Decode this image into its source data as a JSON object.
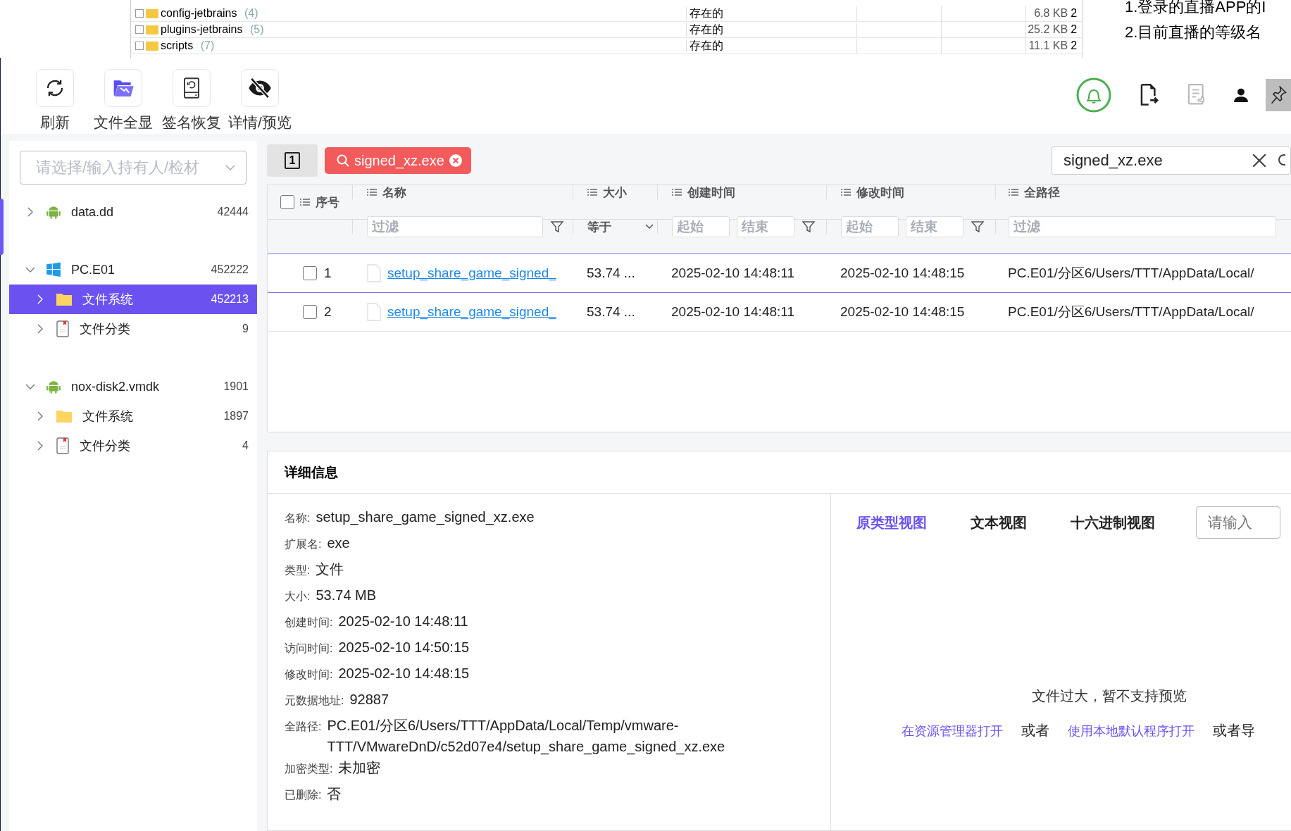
{
  "background_window": {
    "rows": [
      {
        "name": "config-jetbrains",
        "count": "(4)",
        "checked": false,
        "status": "存在的",
        "size": "6.8 KB",
        "col_5": "2"
      },
      {
        "name": "plugins-jetbrains",
        "count": "(5)",
        "checked": false,
        "status": "存在的",
        "size": "25.2 KB",
        "col_5": "2"
      },
      {
        "name": "scripts",
        "count": "(7)",
        "checked": false,
        "status": "存在的",
        "size": "11.1 KB",
        "col_5": "2"
      }
    ],
    "notes": [
      "1.登录的直播APP的I",
      "2.目前直播的等级名"
    ]
  },
  "toolbar": {
    "buttons": [
      {
        "label": "刷新",
        "kind": "refresh"
      },
      {
        "label": "文件全显",
        "kind": "folder"
      },
      {
        "label": "签名恢复",
        "kind": "disk"
      },
      {
        "label": "详情/预览",
        "kind": "eye-off"
      }
    ]
  },
  "sidebar": {
    "owner_select": {
      "placeholder": "请选择/输入持有人/检材"
    },
    "tree": [
      {
        "label": "data.dd",
        "count": "42444",
        "kind": "android",
        "expanded": false,
        "selected": false
      },
      {
        "label": "PC.E01",
        "count": "452222",
        "kind": "windows",
        "expanded": true,
        "selected": false,
        "children": [
          {
            "label": "文件系统",
            "count": "452213",
            "kind": "folder",
            "expanded": false,
            "selected": true
          },
          {
            "label": "文件分类",
            "count": "9",
            "kind": "doc",
            "expanded": false,
            "selected": false
          }
        ]
      },
      {
        "label": "nox-disk2.vmdk",
        "count": "1901",
        "kind": "android",
        "expanded": true,
        "selected": false,
        "children": [
          {
            "label": "文件系统",
            "count": "1897",
            "kind": "folder",
            "expanded": false,
            "selected": false
          },
          {
            "label": "文件分类",
            "count": "4",
            "kind": "doc",
            "expanded": false,
            "selected": false
          }
        ]
      }
    ]
  },
  "search_bar": {
    "tab_number": "1",
    "tag": "signed_xz.exe",
    "value": "signed_xz.exe"
  },
  "table": {
    "columns": [
      "序号",
      "名称",
      "大小",
      "创建时间",
      "修改时间",
      "全路径"
    ],
    "select_all_checked": false,
    "filters": {
      "name": {
        "placeholder": "过滤"
      },
      "size": {
        "value": "等于"
      },
      "created_from": {
        "placeholder": "起始"
      },
      "created_to": {
        "placeholder": "结束"
      },
      "modified_from": {
        "placeholder": "起始"
      },
      "modified_to": {
        "placeholder": "结束"
      },
      "path": {
        "placeholder": "过滤"
      }
    },
    "rows": [
      {
        "index": "1",
        "checked": false,
        "selected": true,
        "name": "setup_share_game_signed_",
        "size": "53.74 ...",
        "created": "2025-02-10 14:48:11",
        "modified": "2025-02-10 14:48:15",
        "path": "PC.E01/分区6/Users/TTT/AppData/Local/"
      },
      {
        "index": "2",
        "checked": false,
        "selected": false,
        "name": "setup_share_game_signed_",
        "size": "53.74 ...",
        "created": "2025-02-10 14:48:11",
        "modified": "2025-02-10 14:48:15",
        "path": "PC.E01/分区6/Users/TTT/AppData/Local/"
      }
    ]
  },
  "details": {
    "title": "详细信息",
    "fields": [
      {
        "label": "名称:",
        "value": "setup_share_game_signed_xz.exe"
      },
      {
        "label": "扩展名:",
        "value": "exe"
      },
      {
        "label": "类型:",
        "value": "文件"
      },
      {
        "label": "大小:",
        "value": "53.74 MB"
      },
      {
        "label": "创建时间:",
        "value": "2025-02-10 14:48:11"
      },
      {
        "label": "访问时间:",
        "value": "2025-02-10 14:50:15"
      },
      {
        "label": "修改时间:",
        "value": "2025-02-10 14:48:15"
      },
      {
        "label": "元数据地址:",
        "value": "92887"
      },
      {
        "label": "全路径:",
        "value": "PC.E01/分区6/Users/TTT/AppData/Local/Temp/vmware-TTT/VMwareDnD/c52d07e4/setup_share_game_signed_xz.exe"
      },
      {
        "label": "加密类型:",
        "value": "未加密"
      },
      {
        "label": "已删除:",
        "value": "否"
      }
    ],
    "preview": {
      "tabs": [
        {
          "label": "原类型视图",
          "selected": true
        },
        {
          "label": "文本视图",
          "selected": false
        },
        {
          "label": "十六进制视图",
          "selected": false
        }
      ],
      "search_placeholder": "请输入",
      "message": "文件过大，暂不支持预览",
      "actions": [
        {
          "kind": "link",
          "text": "在资源管理器打开"
        },
        {
          "kind": "text",
          "text": "或者"
        },
        {
          "kind": "link",
          "text": "使用本地默认程序打开"
        },
        {
          "kind": "text",
          "text": "或者导"
        }
      ]
    }
  }
}
